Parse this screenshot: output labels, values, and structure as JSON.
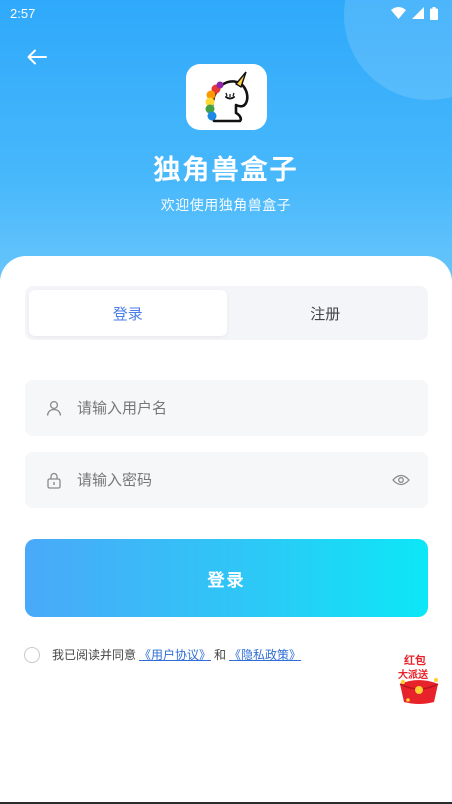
{
  "status_bar": {
    "time": "2:57"
  },
  "header": {
    "app_title": "独角兽盒子",
    "app_subtitle": "欢迎使用独角兽盒子"
  },
  "tabs": [
    {
      "label": "登录",
      "active": true
    },
    {
      "label": "注册",
      "active": false
    }
  ],
  "form": {
    "username_placeholder": "请输入用户名",
    "username_value": "",
    "password_placeholder": "请输入密码",
    "password_value": ""
  },
  "login_button_label": "登录",
  "agreement": {
    "prefix": "我已阅读并同意",
    "user_agreement": "《用户协议》",
    "conjunction": "和",
    "privacy_policy": "《隐私政策》",
    "checked": false
  },
  "promo_badge": {
    "line1": "红包",
    "line2": "大派送"
  },
  "colors": {
    "primary": "#2fa9fb",
    "active_tab_text": "#4c7ee8",
    "link": "#2f6fd6",
    "button_gradient_start": "#4aa9f9",
    "button_gradient_end": "#0ce7f6"
  },
  "icons": {
    "back": "arrow-left-icon",
    "user": "user-icon",
    "lock": "lock-icon",
    "eye": "eye-icon",
    "logo": "unicorn-logo"
  }
}
